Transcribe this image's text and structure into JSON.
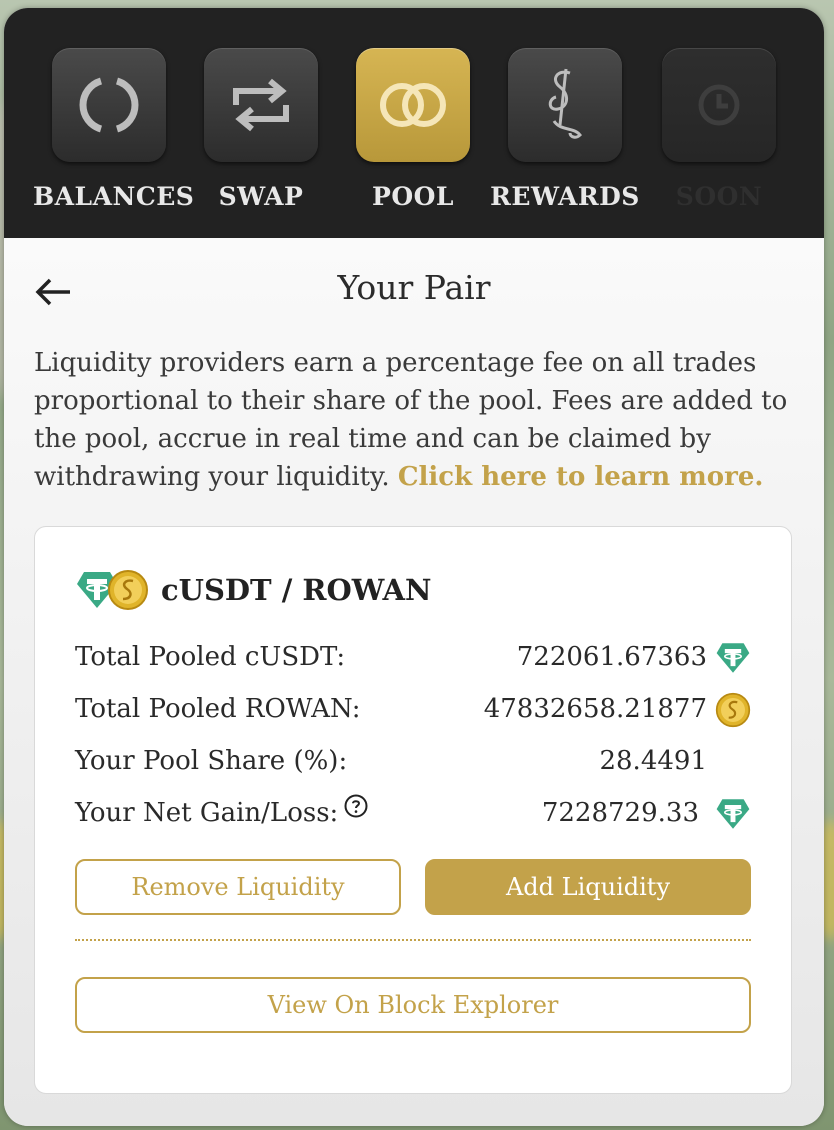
{
  "nav": {
    "items": [
      {
        "label": "BALANCES",
        "icon": "balances-ring-icon",
        "state": "default"
      },
      {
        "label": "SWAP",
        "icon": "swap-arrows-icon",
        "state": "default"
      },
      {
        "label": "POOL",
        "icon": "pool-rings-icon",
        "state": "active"
      },
      {
        "label": "REWARDS",
        "icon": "rewards-sif-icon",
        "state": "default"
      },
      {
        "label": "SOON",
        "icon": "clock-icon",
        "state": "disabled"
      }
    ]
  },
  "page": {
    "title": "Your Pair",
    "description": "Liquidity providers earn a percentage fee on all trades proportional to their share of the pool. Fees are added to the pool, accrue in real time and can be claimed by withdrawing your liquidity. ",
    "learn_more": "Click here to learn more."
  },
  "pair": {
    "name": "cUSDT / ROWAN",
    "rows": [
      {
        "label": "Total Pooled cUSDT:",
        "value": "722061.67363",
        "icon": "tether-icon"
      },
      {
        "label": "Total Pooled ROWAN:",
        "value": "47832658.21877",
        "icon": "rowan-coin-icon"
      },
      {
        "label": "Your Pool Share (%):",
        "value": "28.4491",
        "icon": ""
      },
      {
        "label": "Your Net Gain/Loss:",
        "value": "7228729.33",
        "icon": "tether-icon"
      }
    ],
    "remove_label": "Remove Liquidity",
    "add_label": "Add Liquidity",
    "explorer_label": "View On Block Explorer"
  },
  "colors": {
    "gold": "#c3a24a",
    "tether": "#3aa985",
    "nav_bg": "#222222"
  }
}
